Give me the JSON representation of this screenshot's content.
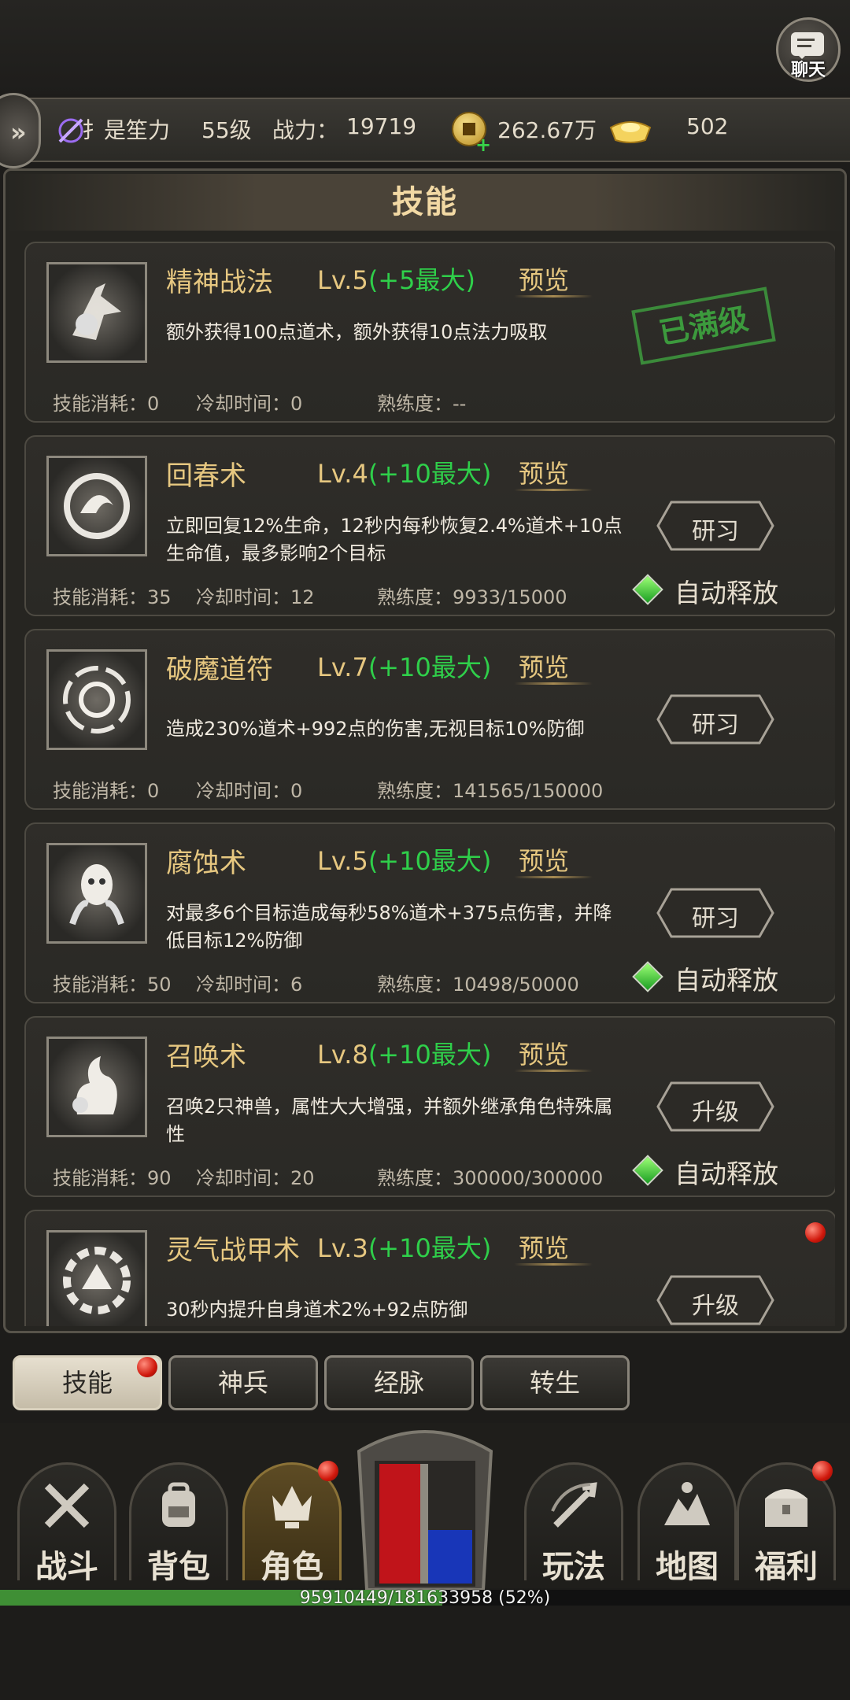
{
  "chat": {
    "label": "聊天"
  },
  "player": {
    "name": "扌是笙力",
    "level": "55级",
    "power_label": "战力：",
    "power": "19719",
    "coins": "262.67万",
    "ingots": "502"
  },
  "panel": {
    "title": "技能"
  },
  "skills": [
    {
      "name": "精神战法",
      "level": "Lv.5",
      "bonus": "(+5最大)",
      "preview": "预览",
      "desc": "额外获得100点道术，额外获得10点法力吸取",
      "cost": "技能消耗：0",
      "cooldown": "冷却时间：0",
      "proficiency": "熟练度：--",
      "stamp": "已满级"
    },
    {
      "name": "回春术",
      "level": "Lv.4",
      "bonus": "(+10最大)",
      "preview": "预览",
      "desc": "立即回复12%生命，12秒内每秒恢复2.4%道术+10点生命值，最多影响2个目标",
      "cost": "技能消耗：35",
      "cooldown": "冷却时间：12",
      "proficiency": "熟练度：9933/15000",
      "button": "研习",
      "auto": "自动释放"
    },
    {
      "name": "破魔道符",
      "level": "Lv.7",
      "bonus": "(+10最大)",
      "preview": "预览",
      "desc": "造成230%道术+992点的伤害,无视目标10%防御",
      "cost": "技能消耗：0",
      "cooldown": "冷却时间：0",
      "proficiency": "熟练度：141565/150000",
      "button": "研习"
    },
    {
      "name": "腐蚀术",
      "level": "Lv.5",
      "bonus": "(+10最大)",
      "preview": "预览",
      "desc": "对最多6个目标造成每秒58%道术+375点伤害，并降低目标12%防御",
      "cost": "技能消耗：50",
      "cooldown": "冷却时间：6",
      "proficiency": "熟练度：10498/50000",
      "button": "研习",
      "auto": "自动释放"
    },
    {
      "name": "召唤术",
      "level": "Lv.8",
      "bonus": "(+10最大)",
      "preview": "预览",
      "desc": "召唤2只神兽，属性大大增强，并额外继承角色特殊属性",
      "cost": "技能消耗：90",
      "cooldown": "冷却时间：20",
      "proficiency": "熟练度：300000/300000",
      "button": "升级",
      "auto": "自动释放"
    },
    {
      "name": "灵气战甲术",
      "level": "Lv.3",
      "bonus": "(+10最大)",
      "preview": "预览",
      "desc": "30秒内提升自身道术2%+92点防御",
      "button": "升级"
    }
  ],
  "subtabs": [
    "技能",
    "神兵",
    "经脉",
    "转生"
  ],
  "nav": [
    "战斗",
    "背包",
    "角色",
    "玩法",
    "地图",
    "福利"
  ],
  "exp": {
    "text": "95910449/181633958 (52%)",
    "fraction": 0.52
  }
}
